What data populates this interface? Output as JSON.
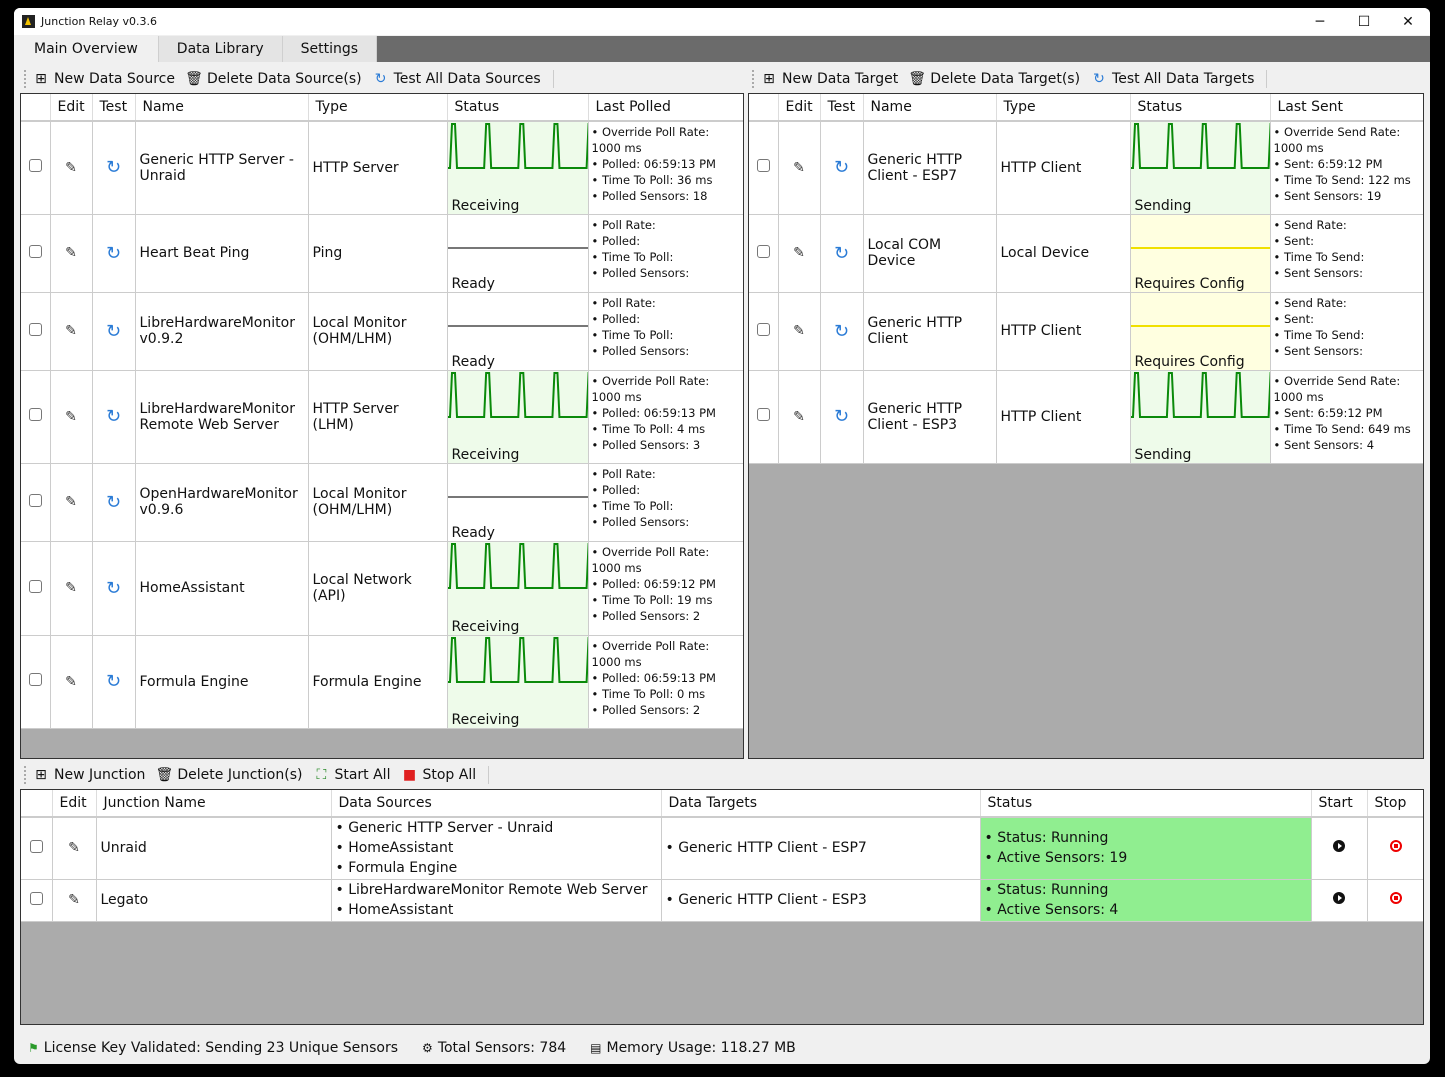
{
  "window": {
    "title": "Junction Relay v0.3.6",
    "minimize": "─",
    "maximize": "☐",
    "close": "✕"
  },
  "tabs": [
    {
      "label": "Main Overview",
      "active": true
    },
    {
      "label": "Data Library"
    },
    {
      "label": "Settings"
    }
  ],
  "colors": {
    "sparkline": "#0a8a0a",
    "receiving_bg": "#eefbea",
    "config_bg": "#ffffe0",
    "config_line": "#f0e000",
    "ready_line": "#777777",
    "running_bg": "#90ee90"
  },
  "sources_toolbar": {
    "new": "New Data Source",
    "delete": "Delete Data Source(s)",
    "test": "Test All Data Sources"
  },
  "sources_columns": [
    "",
    "Edit",
    "Test",
    "Name",
    "Type",
    "Status",
    "Last Polled"
  ],
  "sources": [
    {
      "name": "Generic HTTP Server - Unraid",
      "type": "HTTP Server",
      "status": "Receiving",
      "info": [
        "• Override Poll Rate: 1000 ms",
        "• Polled: 06:59:13 PM",
        "• Time To Poll: 36 ms",
        "• Polled Sensors: 18"
      ]
    },
    {
      "name": "Heart Beat Ping",
      "type": "Ping",
      "status": "Ready",
      "info": [
        "• Poll Rate:",
        "• Polled:",
        "• Time To Poll:",
        "• Polled Sensors:"
      ]
    },
    {
      "name": "LibreHardwareMonitor v0.9.2",
      "type": "Local Monitor (OHM/LHM)",
      "status": "Ready",
      "info": [
        "• Poll Rate:",
        "• Polled:",
        "• Time To Poll:",
        "• Polled Sensors:"
      ]
    },
    {
      "name": "LibreHardwareMonitor Remote Web Server",
      "type": "HTTP Server (LHM)",
      "status": "Receiving",
      "info": [
        "• Override Poll Rate: 1000 ms",
        "• Polled: 06:59:13 PM",
        "• Time To Poll: 4 ms",
        "• Polled Sensors: 3"
      ]
    },
    {
      "name": "OpenHardwareMonitor v0.9.6",
      "type": "Local Monitor (OHM/LHM)",
      "status": "Ready",
      "info": [
        "• Poll Rate:",
        "• Polled:",
        "• Time To Poll:",
        "• Polled Sensors:"
      ]
    },
    {
      "name": "HomeAssistant",
      "type": "Local Network (API)",
      "status": "Receiving",
      "info": [
        "• Override Poll Rate: 1000 ms",
        "• Polled: 06:59:12 PM",
        "• Time To Poll: 19 ms",
        "• Polled Sensors: 2"
      ]
    },
    {
      "name": "Formula Engine",
      "type": "Formula Engine",
      "status": "Receiving",
      "info": [
        "• Override Poll Rate: 1000 ms",
        "• Polled: 06:59:13 PM",
        "• Time To Poll: 0 ms",
        "• Polled Sensors: 2"
      ]
    }
  ],
  "targets_toolbar": {
    "new": "New Data Target",
    "delete": "Delete Data Target(s)",
    "test": "Test All Data Targets"
  },
  "targets_columns": [
    "",
    "Edit",
    "Test",
    "Name",
    "Type",
    "Status",
    "Last Sent"
  ],
  "targets": [
    {
      "name": "Generic HTTP Client - ESP7",
      "type": "HTTP Client",
      "status": "Sending",
      "info": [
        "• Override Send Rate: 1000 ms",
        "• Sent: 6:59:12 PM",
        "• Time To Send: 122 ms",
        "• Sent Sensors: 19"
      ]
    },
    {
      "name": "Local COM Device",
      "type": "Local Device",
      "status": "Requires Config",
      "info": [
        "• Send Rate:",
        "• Sent:",
        "• Time To Send:",
        "• Sent Sensors:"
      ]
    },
    {
      "name": "Generic HTTP Client",
      "type": "HTTP Client",
      "status": "Requires Config",
      "info": [
        "• Send Rate:",
        "• Sent:",
        "• Time To Send:",
        "• Sent Sensors:"
      ]
    },
    {
      "name": "Generic HTTP Client - ESP3",
      "type": "HTTP Client",
      "status": "Sending",
      "info": [
        "• Override Send Rate: 1000 ms",
        "• Sent: 6:59:12 PM",
        "• Time To Send: 649 ms",
        "• Sent Sensors: 4"
      ]
    }
  ],
  "junctions_toolbar": {
    "new": "New Junction",
    "delete": "Delete Junction(s)",
    "start": "Start All",
    "stop": "Stop All"
  },
  "junctions_columns": [
    "",
    "Edit",
    "Junction Name",
    "Data Sources",
    "Data Targets",
    "Status",
    "Start",
    "Stop"
  ],
  "junctions": [
    {
      "name": "Unraid",
      "sources": [
        "• Generic HTTP Server - Unraid",
        "• HomeAssistant",
        "• Formula Engine"
      ],
      "targets": [
        "• Generic HTTP Client - ESP7"
      ],
      "status": [
        "• Status: Running",
        "• Active Sensors: 19"
      ]
    },
    {
      "name": "Legato",
      "sources": [
        "• LibreHardwareMonitor Remote Web Server",
        "• HomeAssistant"
      ],
      "targets": [
        "• Generic HTTP Client - ESP3"
      ],
      "status": [
        "• Status: Running",
        "• Active Sensors: 4"
      ]
    }
  ],
  "statusbar": {
    "license": "License Key Validated: Sending 23 Unique Sensors",
    "total": "Total Sensors: 784",
    "memory": "Memory Usage: 118.27 MB"
  }
}
